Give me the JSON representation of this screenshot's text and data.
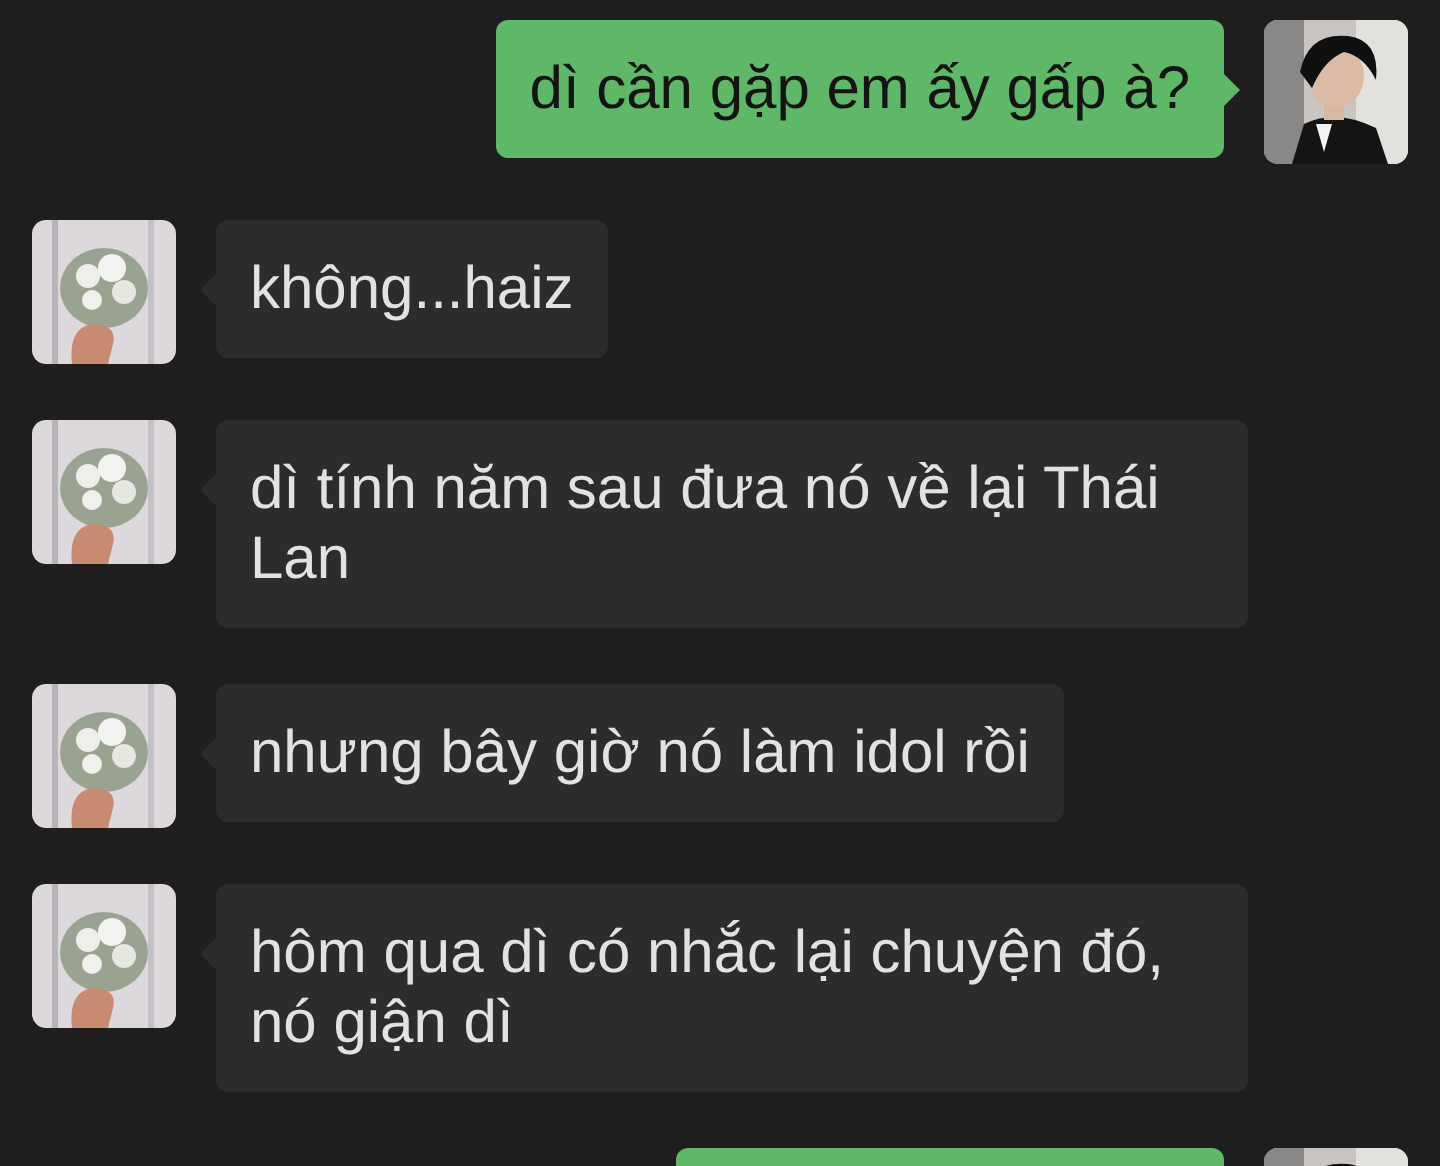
{
  "messages": [
    {
      "kind": "outgoing",
      "text": "dì cần gặp em ấy gấp à?"
    },
    {
      "kind": "incoming",
      "text": "không...haiz"
    },
    {
      "kind": "incoming",
      "text": "dì tính năm sau đưa nó về lại Thái Lan"
    },
    {
      "kind": "incoming",
      "text": "nhưng bây giờ nó làm idol rồi"
    },
    {
      "kind": "incoming",
      "text": "hôm qua dì có nhắc lại chuyện đó, nó giận dì"
    },
    {
      "kind": "outgoing"
    }
  ]
}
